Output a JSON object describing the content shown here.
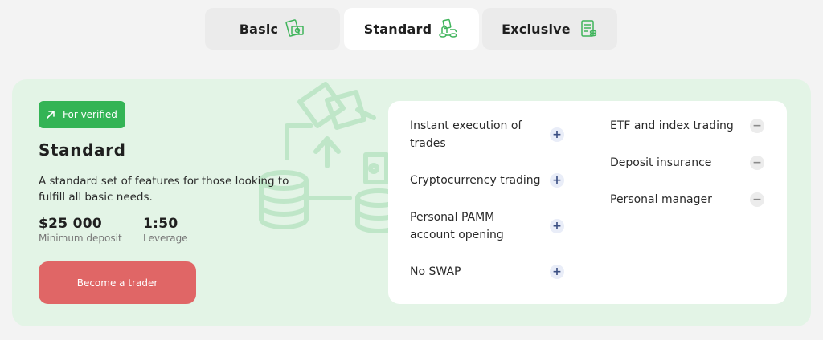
{
  "tabs": [
    {
      "label": "Basic",
      "icon": "money-bills-icon",
      "active": false
    },
    {
      "label": "Standard",
      "icon": "money-exchange-icon",
      "active": true
    },
    {
      "label": "Exclusive",
      "icon": "money-document-icon",
      "active": false
    }
  ],
  "plan": {
    "badge": "For verified",
    "title": "Standard",
    "description": "A standard set of features for those looking to fulfill all basic needs.",
    "min_deposit": {
      "value": "$25 000",
      "label": "Minimum deposit"
    },
    "leverage": {
      "value": "1:50",
      "label": "Leverage"
    },
    "cta": "Become a trader"
  },
  "features": {
    "included": [
      "Instant execution of trades",
      "Cryptocurrency trading",
      "Personal PAMM account opening",
      "No SWAP"
    ],
    "excluded": [
      "ETF and index trading",
      "Deposit insurance",
      "Personal manager"
    ]
  },
  "colors": {
    "accent_green": "#33b455",
    "card_bg": "#e3f4e6",
    "cta_red": "#e06666"
  }
}
